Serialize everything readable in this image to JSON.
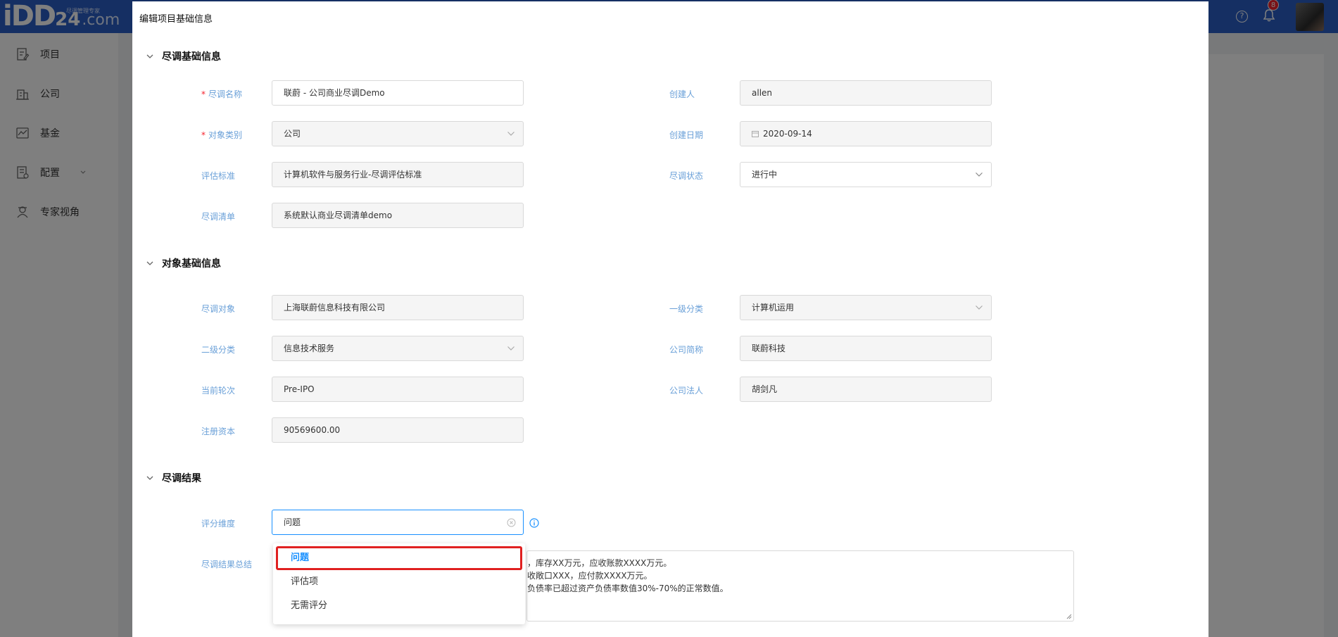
{
  "header": {
    "logo_main": "iDD",
    "logo_num": "24",
    "logo_com": ".com",
    "logo_tagline": "尽调管理专家",
    "help_glyph": "?",
    "notification_count": "8",
    "brand_color": "#2b5fc7"
  },
  "sidebar": {
    "items": [
      {
        "label": "项目",
        "icon": "edit-document-icon"
      },
      {
        "label": "公司",
        "icon": "building-icon"
      },
      {
        "label": "基金",
        "icon": "chart-line-icon"
      },
      {
        "label": "配置",
        "icon": "settings-doc-icon",
        "has_submenu": true
      },
      {
        "label": "专家视角",
        "icon": "expert-icon"
      }
    ]
  },
  "modal": {
    "title": "编辑项目基础信息",
    "sections": {
      "basic": "尽调基础信息",
      "target": "对象基础信息",
      "result": "尽调结果"
    },
    "basic": {
      "name_label": "尽调名称",
      "name_value": "联蔚 - 公司商业尽调Demo",
      "creator_label": "创建人",
      "creator_value": "allen",
      "type_label": "对象类别",
      "type_value": "公司",
      "date_label": "创建日期",
      "date_value": "2020-09-14",
      "standard_label": "评估标准",
      "standard_value": "计算机软件与服务行业-尽调评估标准",
      "status_label": "尽调状态",
      "status_value": "进行中",
      "checklist_label": "尽调清单",
      "checklist_value": "系统默认商业尽调清单demo"
    },
    "target": {
      "object_label": "尽调对象",
      "object_value": "上海联蔚信息科技有限公司",
      "cat1_label": "一级分类",
      "cat1_value": "计算机运用",
      "cat2_label": "二级分类",
      "cat2_value": "信息技术服务",
      "short_label": "公司简称",
      "short_value": "联蔚科技",
      "round_label": "当前轮次",
      "round_value": "Pre-IPO",
      "legal_label": "公司法人",
      "legal_value": "胡剑凡",
      "capital_label": "注册资本",
      "capital_value": "90569600.00"
    },
    "result": {
      "dimension_label": "评分维度",
      "dimension_value": "问题",
      "summary_label": "尽调结果总结",
      "summary_lines": [
        "，库存XX万元，应收账款XXXX万元。",
        "收敞口XXX，应付款XXXX万元。",
        "负债率已超过资产负债率数值30%-70%的正常数值。"
      ]
    },
    "dropdown_options": [
      "问题",
      "评估项",
      "无需评分"
    ]
  }
}
